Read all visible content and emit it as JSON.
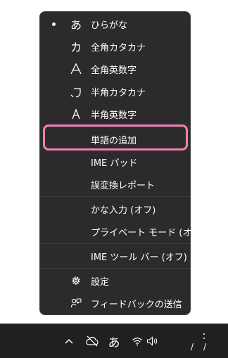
{
  "menu": {
    "items": [
      {
        "label": "ひらがな",
        "icon": "あ",
        "icon_name": "hiragana-icon",
        "selected": true
      },
      {
        "label": "全角カタカナ",
        "icon": "カ",
        "icon_name": "fullwidth-katakana-icon"
      },
      {
        "label": "全角英数字",
        "icon": "A",
        "icon_name": "fullwidth-alphanumeric-icon"
      },
      {
        "label": "半角カタカナ",
        "icon": "ｶ",
        "icon_name": "halfwidth-katakana-icon"
      },
      {
        "label": "半角英数字",
        "icon": "A",
        "icon_name": "halfwidth-alphanumeric-icon"
      },
      {
        "label": "単語の追加"
      },
      {
        "label": "IME パッド"
      },
      {
        "label": "誤変換レポート"
      },
      {
        "label": "かな入力 (オフ)"
      },
      {
        "label": "プライベート モード (オフ)"
      },
      {
        "label": "IME ツール バー (オフ)"
      },
      {
        "label": "設定",
        "icon_name": "gear-icon"
      },
      {
        "label": "フィードバックの送信",
        "icon_name": "feedback-icon"
      }
    ]
  },
  "taskbar": {
    "ime_mode": "あ",
    "clock_line1": "/",
    "clock_line2": "/"
  },
  "colors": {
    "menu_bg": "#2b2b2b",
    "highlight": "#f27fb4",
    "taskbar_bg": "#202020"
  }
}
